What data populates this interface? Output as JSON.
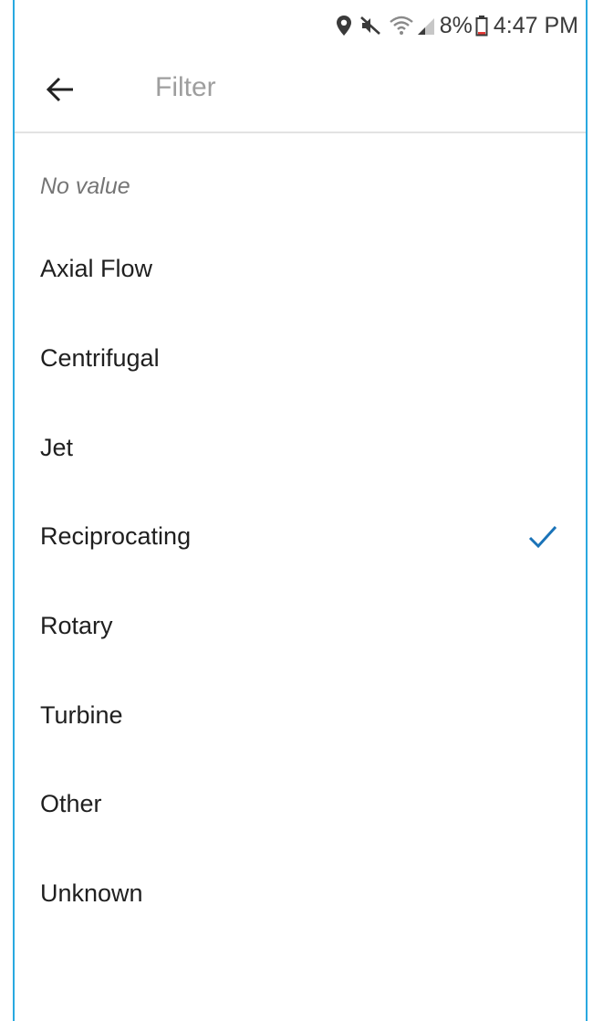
{
  "status_bar": {
    "battery_text": "8%",
    "time": "4:47 PM",
    "icons": [
      "location-icon",
      "mute-icon",
      "wifi-icon",
      "signal-icon",
      "battery-icon"
    ]
  },
  "toolbar": {
    "title": "Filter",
    "back_icon": "arrow-left-icon"
  },
  "filter": {
    "no_value_label": "No value",
    "options": [
      {
        "label": "Axial Flow",
        "selected": false
      },
      {
        "label": "Centrifugal",
        "selected": false
      },
      {
        "label": "Jet",
        "selected": false
      },
      {
        "label": "Reciprocating",
        "selected": true
      },
      {
        "label": "Rotary",
        "selected": false
      },
      {
        "label": "Turbine",
        "selected": false
      },
      {
        "label": "Other",
        "selected": false
      },
      {
        "label": "Unknown",
        "selected": false
      }
    ]
  },
  "colors": {
    "accent": "#1a73b8",
    "frame_border": "#29a9e0",
    "title_gray": "#9e9e9e"
  }
}
